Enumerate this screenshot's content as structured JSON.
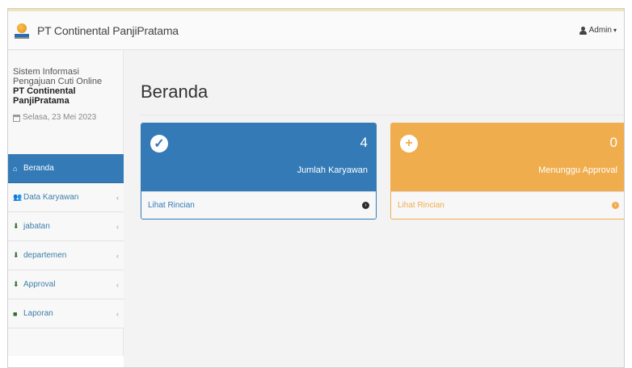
{
  "navbar": {
    "brand": "PT Continental PanjiPratama",
    "user": "Admin",
    "icons": {
      "user": "user-icon",
      "caret": "caret-down-icon"
    }
  },
  "sidebar": {
    "title": "Sistem Informasi Pengajuan Cuti Online",
    "company": "PT Continental PanjiPratama",
    "date": "Selasa, 23 Mei 2023",
    "items": [
      {
        "label": "Beranda",
        "icon": "home-icon",
        "active": true
      },
      {
        "label": "Data Karyawan",
        "icon": "users-icon",
        "active": false
      },
      {
        "label": "jabatan",
        "icon": "download-icon",
        "active": false
      },
      {
        "label": "departemen",
        "icon": "download-icon",
        "active": false
      },
      {
        "label": "Approval",
        "icon": "download-icon",
        "active": false
      },
      {
        "label": "Laporan",
        "icon": "folder-icon",
        "active": false
      }
    ]
  },
  "main": {
    "title": "Beranda",
    "cards": [
      {
        "count": "4",
        "label": "Jumlah Karyawan",
        "link": "Lihat Rincian",
        "color": "#337ab7",
        "icon": "check-circle-icon"
      },
      {
        "count": "0",
        "label": "Menunggu Approval",
        "link": "Lihat Rincian",
        "color": "#f0ad4e",
        "icon": "plus-circle-icon"
      }
    ]
  }
}
